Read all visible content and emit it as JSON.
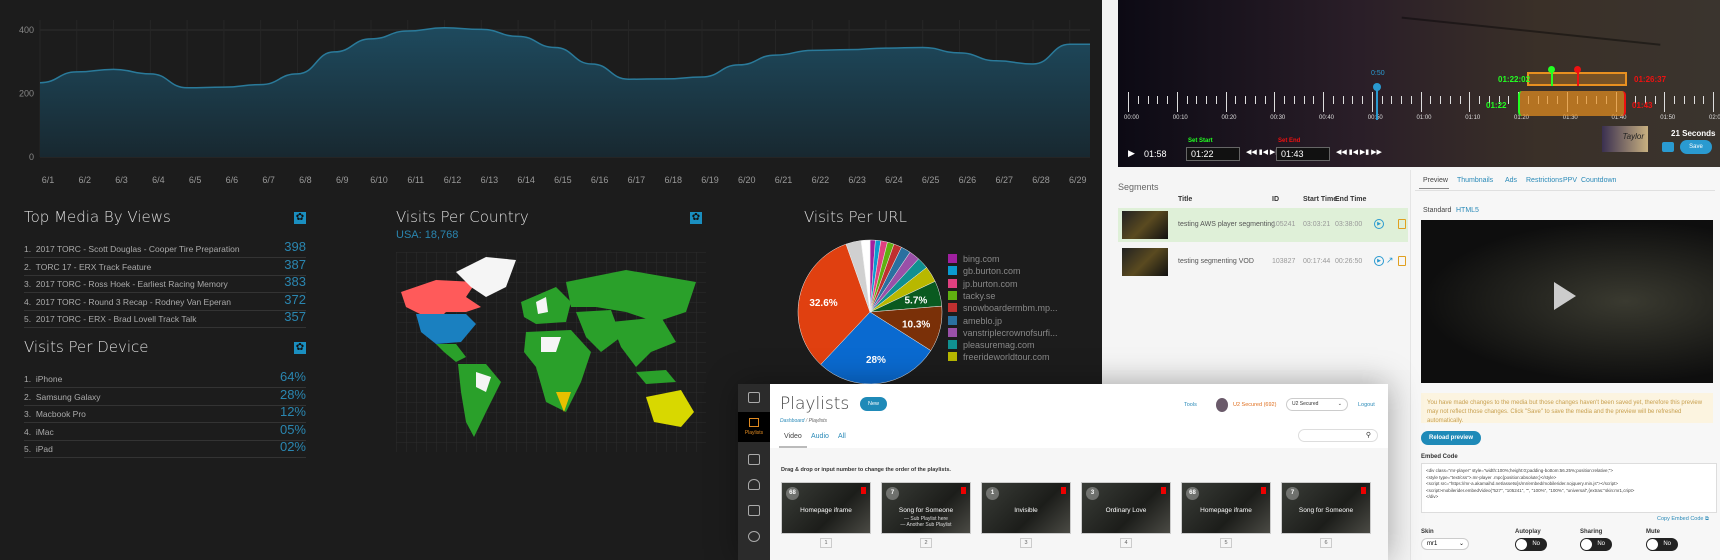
{
  "chart_data": [
    {
      "type": "area",
      "x": [
        "6/1",
        "6/2",
        "6/3",
        "6/4",
        "6/5",
        "6/6",
        "6/7",
        "6/8",
        "6/9",
        "6/10",
        "6/11",
        "6/12",
        "6/13",
        "6/14",
        "6/15",
        "6/16",
        "6/17",
        "6/18",
        "6/19",
        "6/20",
        "6/21",
        "6/22",
        "6/23",
        "6/24",
        "6/25",
        "6/26",
        "6/27",
        "6/28",
        "6/29"
      ],
      "values": [
        234,
        268,
        276,
        262,
        218,
        220,
        228,
        262,
        331,
        372,
        397,
        407,
        402,
        380,
        345,
        293,
        245,
        246,
        252,
        290,
        321,
        336,
        338,
        343,
        345,
        328,
        303,
        293,
        355
      ],
      "yticks": [
        0,
        200,
        400
      ],
      "ylim": [
        0,
        440
      ],
      "grid": true,
      "title": ""
    },
    {
      "type": "pie",
      "title": "Visits Per URL",
      "slices": [
        {
          "label": "bing.com",
          "value": 1.2,
          "color": "#a020a0"
        },
        {
          "label": "gb.burton.com",
          "value": 1.2,
          "color": "#0a9ad0"
        },
        {
          "label": "jp.burton.com",
          "value": 1.5,
          "color": "#e04080"
        },
        {
          "label": "tacky.se",
          "value": 1.5,
          "color": "#60b010"
        },
        {
          "label": "snowboardermbm.mp...",
          "value": 1.8,
          "color": "#c03030"
        },
        {
          "label": "ameblo.jp",
          "value": 2.2,
          "color": "#2a70a0"
        },
        {
          "label": "vanstriplecrownofsurfi...",
          "value": 2.4,
          "color": "#9a50a8"
        },
        {
          "label": "pleasuremag.com",
          "value": 2.6,
          "color": "#109090"
        },
        {
          "label": "freerideworldtour.com",
          "value": 3.6,
          "color": "#b8b800"
        },
        {
          "label": "",
          "value": 5.7,
          "color": "#0a5a20",
          "shown": "5.7%"
        },
        {
          "label": "",
          "value": 10.3,
          "color": "#7a3008",
          "shown": "10.3%"
        },
        {
          "label": "",
          "value": 28,
          "color": "#0a6ad0",
          "shown": "28%"
        },
        {
          "label": "",
          "value": 32.6,
          "color": "#e04010",
          "shown": "32.6%"
        },
        {
          "label": "",
          "value": 3.4,
          "color": "#d0d0d0"
        },
        {
          "label": "",
          "value": 2.0,
          "color": "#ffffff"
        }
      ]
    }
  ],
  "top_media": {
    "title": "Top Media By Views",
    "items": [
      {
        "rank": "1.",
        "name": "2017 TORC - Scott Douglas - Cooper Tire Preparation",
        "value": "398"
      },
      {
        "rank": "2.",
        "name": "TORC 17 - ERX Track Feature",
        "value": "387"
      },
      {
        "rank": "3.",
        "name": "2017 TORC - Ross Hoek - Earliest Racing Memory",
        "value": "383"
      },
      {
        "rank": "4.",
        "name": "2017 TORC - Round 3 Recap - Rodney Van Eperan",
        "value": "372"
      },
      {
        "rank": "5.",
        "name": "2017 TORC - ERX - Brad Lovell Track Talk",
        "value": "357"
      }
    ]
  },
  "devices": {
    "title": "Visits Per Device",
    "items": [
      {
        "rank": "1.",
        "name": "iPhone",
        "value": "64%"
      },
      {
        "rank": "2.",
        "name": "Samsung Galaxy",
        "value": "28%"
      },
      {
        "rank": "3.",
        "name": "Macbook Pro",
        "value": "12%"
      },
      {
        "rank": "4.",
        "name": "iMac",
        "value": "05%"
      },
      {
        "rank": "5.",
        "name": "iPad",
        "value": "02%"
      }
    ]
  },
  "country": {
    "title": "Visits Per Country",
    "summary": "USA: 18,768"
  },
  "editor": {
    "marker": "0:50",
    "sel_start_precise": "01:22:02",
    "sel_end_precise": "01:26:37",
    "sel_start": "01:22",
    "sel_end": "01:43",
    "ticks": [
      "00:00",
      "00:10",
      "00:20",
      "00:30",
      "00:40",
      "00:50",
      "01:00",
      "01:10",
      "01:20",
      "01:30",
      "01:40",
      "01:50",
      "02:00"
    ],
    "current_time": "01:58",
    "set_start_label": "Set Start",
    "set_end_label": "Set End",
    "set_start_value": "01:22",
    "set_end_value": "01:43",
    "duration": "21 Seconds",
    "save": "Save",
    "thumb_text": "Taylor"
  },
  "segments": {
    "title": "Segments",
    "headers": [
      "Title",
      "ID",
      "Start Time",
      "End Time"
    ],
    "rows": [
      {
        "title": "testing AWS player segmenting",
        "id": "105241",
        "start": "03:03:21",
        "end": "03:38:00"
      },
      {
        "title": "testing segmenting VOD",
        "id": "103827",
        "start": "00:17:44",
        "end": "00:26:50"
      }
    ]
  },
  "preview": {
    "tabs": [
      "Preview",
      "Thumbnails",
      "Ads",
      "Restrictions",
      "PPV",
      "Countdown"
    ],
    "subtabs": [
      "Standard",
      "HTML5"
    ],
    "warning": "You have made changes to the media but those changes haven't been saved yet, therefore this preview may not reflect those changes. Click \"Save\" to save the media and the preview will be refreshed automatically.",
    "reload": "Reload preview",
    "embed_label": "Embed Code",
    "embed_lines": [
      "<div class=\"mr-player\" style=\"width:100%;height:0;padding-bottom:56.25%;position:relative;\">",
      "<style type=\"text/css\">.mr-player .mpc{position:absolute;}</style>",
      "<script src=\"https://mr-a.akamaihd.net/assets/js/mr/embed/mobilerider.nojquery.min.js\"></script>",
      "<script>mobilerider.embedVideo(\"527\", \"105241\", \"\", \"100%\", \"100%\", \"universal\",{extras:\"skin:mr1,cript>",
      "</div>"
    ],
    "copy": "Copy Embed Code",
    "skin_label": "Skin",
    "skin_value": "mr1",
    "autoplay_label": "Autoplay",
    "autoplay": "No",
    "sharing_label": "Sharing",
    "sharing": "No",
    "mute_label": "Mute",
    "mute": "No"
  },
  "playlists": {
    "nav_label": "Playlists",
    "title": "Playlists",
    "new": "New",
    "breadcrumb": [
      "Dashboard",
      "Playlists"
    ],
    "tabs": [
      "Video",
      "Audio",
      "All"
    ],
    "tools": "Tools",
    "user": "U2 Secured (692)",
    "account": "U2 Secured",
    "logout": "Logout",
    "search_placeholder": "",
    "instructions": "Drag & drop or input number to change the order of the playlists.",
    "tiles": [
      {
        "count": "68",
        "title": "Homepage iframe",
        "order": "1"
      },
      {
        "count": "7",
        "title": "Song for Someone",
        "sub": [
          "— Sub Playlist here",
          "— Another Sub Playlist"
        ],
        "order": "2"
      },
      {
        "count": "1",
        "title": "Invisible",
        "order": "3"
      },
      {
        "count": "3",
        "title": "Ordinary Love",
        "order": "4"
      },
      {
        "count": "68",
        "title": "Homepage iframe",
        "order": "5"
      },
      {
        "count": "7",
        "title": "Song for Someone",
        "order": "6"
      }
    ]
  }
}
